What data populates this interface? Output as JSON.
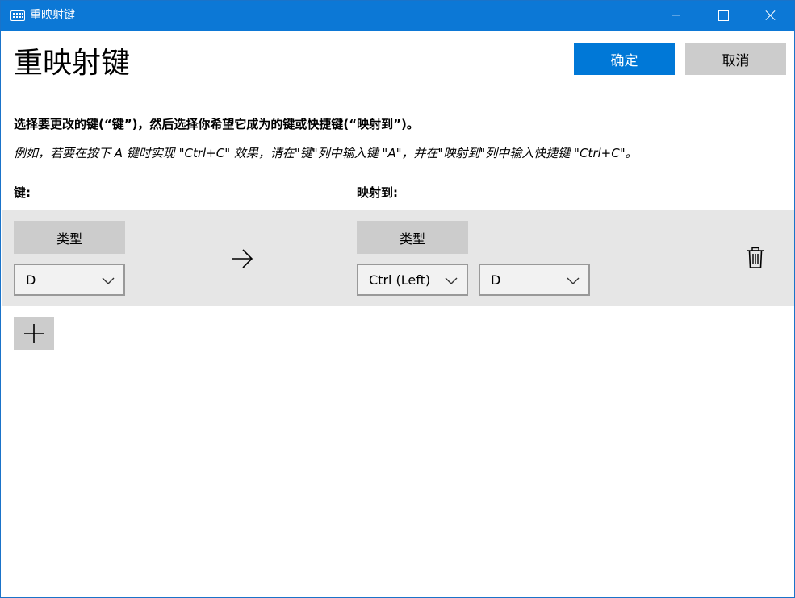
{
  "window": {
    "title": "重映射键",
    "accent": "#0078d7",
    "titlebar_color": "#0c78d6"
  },
  "header": {
    "heading": "重映射键",
    "ok_label": "确定",
    "cancel_label": "取消"
  },
  "instructions": {
    "main": "选择要更改的键(“键”)，然后选择你希望它成为的键或快捷键(“映射到”)。",
    "example": "例如，若要在按下 A 键时实现 \"Ctrl+C\" 效果，请在\"键\"列中输入键 \"A\"，并在\"映射到\"列中输入快捷键 \"Ctrl+C\"。"
  },
  "columns": {
    "key": "键:",
    "mapped_to": "映射到:"
  },
  "remap_rows": [
    {
      "key_type_label": "类型",
      "key_value": "D",
      "map_type_label": "类型",
      "map_modifier": "Ctrl (Left)",
      "map_key": "D"
    }
  ],
  "icons": {
    "app": "keyboard-icon",
    "arrow": "arrow-right-icon",
    "delete": "trash-icon",
    "add": "plus-icon",
    "dropdown": "chevron-down-icon"
  }
}
